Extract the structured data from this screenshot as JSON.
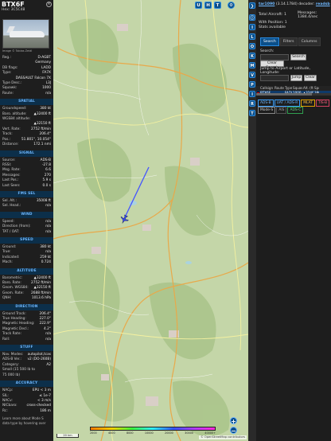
{
  "info": {
    "callsign": "BTX6F",
    "hex": "Hex: 3C5C48",
    "photo_credit": "Image © Tobias Zeidl",
    "rows1": [
      {
        "k": "Reg.:",
        "v": "D-AGBT"
      },
      {
        "k": "",
        "v": "Germany"
      },
      {
        "k": "DB flags:",
        "v": "LADD"
      },
      {
        "k": "Type:",
        "v": "FA7X"
      },
      {
        "k": "",
        "v": "DASSAULT Falcon 7X"
      },
      {
        "k": "Type Desc.:",
        "v": "L3J"
      },
      {
        "k": "Squawk:",
        "v": "1000"
      },
      {
        "k": "Route:",
        "v": "n/a"
      }
    ],
    "spatial_title": "SPATIAL",
    "spatial": [
      {
        "k": "Groundspeed:",
        "v": "380 kt"
      },
      {
        "k": "Baro. altitude:",
        "v": "▲32400 ft"
      },
      {
        "k": "WGS84 altitude:",
        "v": ""
      },
      {
        "k": "",
        "v": "▲32150 ft"
      },
      {
        "k": "Vert. Rate:",
        "v": "2752 ft/min"
      },
      {
        "k": "Track:",
        "v": "206.4°"
      },
      {
        "k": "Pos.:",
        "v": "51.801°, 10.054°"
      },
      {
        "k": "Distance:",
        "v": "172.1 nmi"
      }
    ],
    "signal_title": "SIGNAL",
    "signal": [
      {
        "k": "Source:",
        "v": "ADS-B"
      },
      {
        "k": "RSSI:",
        "v": "-27.8"
      },
      {
        "k": "Msg. Rate:",
        "v": "6.6"
      },
      {
        "k": "Messages:",
        "v": "270"
      },
      {
        "k": "Last Pos.:",
        "v": "5.9 s"
      },
      {
        "k": "Last Seen:",
        "v": "0.0 s"
      }
    ],
    "fms_title": "FMS SEL",
    "fms": [
      {
        "k": "Sel. Alt.:",
        "v": "35008 ft"
      },
      {
        "k": "Sel. Head.:",
        "v": "n/a"
      }
    ],
    "wind_title": "WIND",
    "wind": [
      {
        "k": "Speed:",
        "v": "n/a"
      },
      {
        "k": "Direction (from):",
        "v": "n/a"
      },
      {
        "k": "TAT / OAT:",
        "v": "n/a"
      }
    ],
    "speed_title": "SPEED",
    "speed": [
      {
        "k": "Ground:",
        "v": "380 kt"
      },
      {
        "k": "True:",
        "v": "n/a"
      },
      {
        "k": "Indicated:",
        "v": "259 kt"
      },
      {
        "k": "Mach:",
        "v": "0.724"
      }
    ],
    "altitude_title": "ALTITUDE",
    "altitude": [
      {
        "k": "Barometric:",
        "v": "▲32400 ft"
      },
      {
        "k": "Baro. Rate:",
        "v": "2752 ft/min"
      },
      {
        "k": "Geom. WGS84:",
        "v": "▲32150 ft"
      },
      {
        "k": "Geom. Rate:",
        "v": "2688 ft/min"
      },
      {
        "k": "QNH:",
        "v": "1013.6 hPa"
      }
    ],
    "direction_title": "DIRECTION",
    "direction": [
      {
        "k": "Ground Track:",
        "v": "206.4°"
      },
      {
        "k": "True Heading:",
        "v": "227.0°"
      },
      {
        "k": "Magnetic Heading:",
        "v": "222.9°"
      },
      {
        "k": "Magnetic Decl.:",
        "v": "4.2°"
      },
      {
        "k": "Track Rate:",
        "v": "n/a"
      },
      {
        "k": "Roll:",
        "v": "n/a"
      }
    ],
    "stuff_title": "STUFF",
    "stuff": [
      {
        "k": "Nav. Modes:",
        "v": "autopilot,tcas"
      },
      {
        "k": "ADS-B Ver.:",
        "v": "v2 (DO-260B)"
      },
      {
        "k": "Category:",
        "v": "A2"
      },
      {
        "k": "Small (15 500 lb to",
        "v": ""
      },
      {
        "k": "75 000 lb)",
        "v": ""
      }
    ],
    "accuracy_title": "ACCURACY",
    "accuracy": [
      {
        "k": "NACp:",
        "v": "EPU < 3 m"
      },
      {
        "k": "SIL:",
        "v": "≤ 1e-7"
      },
      {
        "k": "NACv:",
        "v": "< 3 m/s"
      },
      {
        "k": "NICbaro:",
        "v": "cross-checked"
      },
      {
        "k": "Rc:",
        "v": "186 m"
      }
    ],
    "footer1": "Learn more about Mode S",
    "footer2": "data type by hovering over"
  },
  "map": {
    "top_buttons": [
      "U",
      "H",
      "T"
    ],
    "zoom_in": "+",
    "zoom_out": "−",
    "scale_label": "20 km",
    "attribution": "© OpenStreetMap contributors",
    "alt_labels": [
      "2000",
      "4000",
      "8000",
      "10000",
      "20000",
      "30000",
      "40000+"
    ],
    "water_color": "#aad3df",
    "track_color": "#4455ff",
    "plane_color": "#3344ee"
  },
  "side_buttons": [
    "",
    "I",
    "L",
    "O",
    "K",
    "M",
    "V",
    "P",
    "I",
    "R",
    "T"
  ],
  "right": {
    "version_prefix": "tar1090",
    "version_suffix": " (3.14.1784) decoder: ",
    "version_link": "readsb",
    "total_label": "Total Aircraft:",
    "total_value": "1",
    "messages_label": "Messages:",
    "messages_value": "1384.4/sec",
    "with_pos_label": "With Position:",
    "with_pos_value": "1",
    "stats_label": "Stats available",
    "tabs": [
      "Search",
      "Filters",
      "Columns"
    ],
    "search_label": "Search:",
    "search_button": "Search",
    "clear_search": "Clear Search",
    "jump_label": "Jump to Airport or Latitude, Longitude:",
    "jump_button": "Jump",
    "clear_button": "Clear",
    "table_headers": [
      "",
      "Callsign",
      "Route",
      "Type",
      "Squawk",
      "Alt. (ft)",
      "Spd"
    ],
    "table_row": [
      "",
      "BTX6F",
      "",
      "FA7X",
      "1000",
      "▲32400",
      "380"
    ],
    "legend_row1": [
      "ADS-B",
      "UAT / ADS-R",
      "MLAT",
      "TIS-B"
    ],
    "legend_row2": [
      "Mode-S",
      "AIS",
      "ADS-C"
    ]
  }
}
